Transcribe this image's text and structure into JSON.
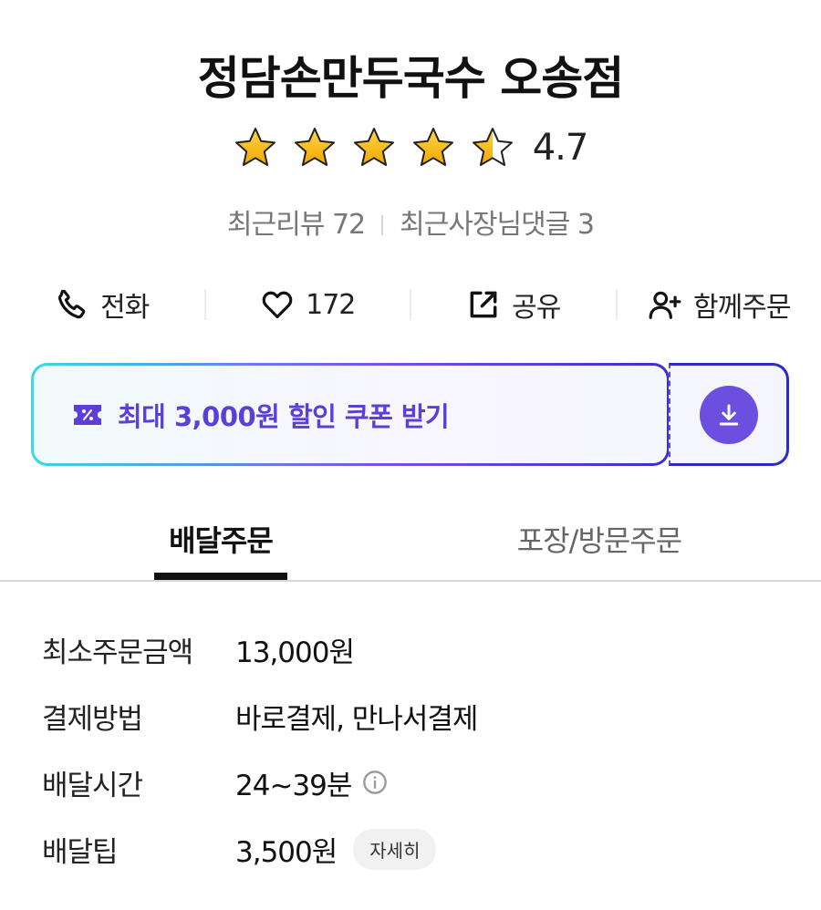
{
  "store": {
    "name": "정담손만두국수 오송점",
    "rating": "4.7",
    "rating_value": 4.7,
    "stars_max": 5,
    "recent_reviews": "최근리뷰 72",
    "recent_owner_replies": "최근사장님댓글 3"
  },
  "actions": {
    "call_label": "전화",
    "like_count": "172",
    "share_label": "공유",
    "group_order_label": "함께주문"
  },
  "coupon": {
    "text": "최대 3,000원 할인 쿠폰 받기"
  },
  "tabs": {
    "delivery": "배달주문",
    "pickup": "포장/방문주문",
    "active": "delivery"
  },
  "info": {
    "min_order_label": "최소주문금액",
    "min_order_value": "13,000원",
    "payment_label": "결제방법",
    "payment_value": "바로결제, 만나서결제",
    "delivery_time_label": "배달시간",
    "delivery_time_value": "24~39분",
    "delivery_tip_label": "배달팁",
    "delivery_tip_value": "3,500원",
    "detail_button": "자세히"
  },
  "colors": {
    "accent": "#6d4fe0",
    "star": "#f5b400",
    "coupon_text": "#5b3fd6"
  },
  "icons": [
    "star-icon",
    "phone-icon",
    "heart-icon",
    "share-icon",
    "user-plus-icon",
    "coupon-icon",
    "download-icon",
    "info-icon"
  ]
}
